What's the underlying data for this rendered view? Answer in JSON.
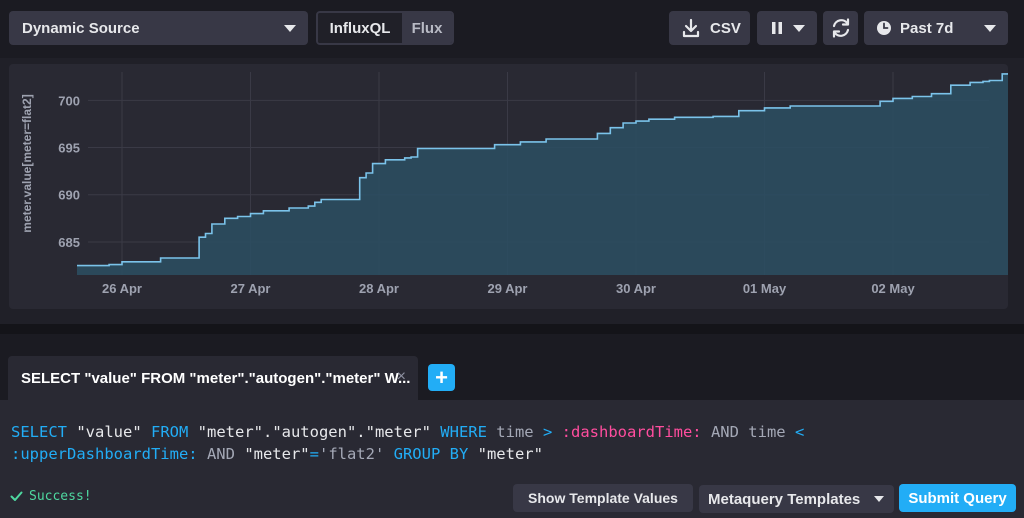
{
  "toolbar": {
    "source_label": "Dynamic Source",
    "lang_influxql": "InfluxQL",
    "lang_flux": "Flux",
    "csv_label": "CSV",
    "time_range_label": "Past 7d"
  },
  "chart_data": {
    "type": "area",
    "ylabel": "meter.value[meter=flat2]",
    "xlabel": "",
    "x_ticks": [
      "26 Apr",
      "27 Apr",
      "28 Apr",
      "29 Apr",
      "30 Apr",
      "01 May",
      "02 May"
    ],
    "y_ticks": [
      685,
      690,
      695,
      700
    ],
    "ylim": [
      681.5,
      703
    ],
    "grid": true,
    "series": [
      {
        "color": "#7bc3ea",
        "x": [
          25.65,
          25.9,
          26.0,
          26.3,
          26.55,
          26.6,
          26.65,
          26.7,
          26.8,
          26.9,
          27.0,
          27.1,
          27.3,
          27.45,
          27.5,
          27.55,
          27.65,
          27.75,
          27.85,
          27.87,
          27.9,
          27.95,
          28.05,
          28.2,
          28.25,
          28.3,
          28.35,
          28.6,
          28.75,
          28.9,
          29.1,
          29.3,
          29.5,
          29.7,
          29.8,
          29.9,
          30.0,
          30.1,
          30.3,
          30.6,
          30.8,
          31.0,
          31.2,
          31.5,
          31.7,
          31.9,
          32.0,
          32.15,
          32.3,
          32.45,
          32.55,
          32.6,
          32.7,
          32.75,
          32.85,
          32.9
        ],
        "y": [
          682.5,
          682.6,
          682.9,
          683.3,
          683.3,
          685.5,
          685.9,
          686.9,
          687.5,
          687.7,
          688.0,
          688.3,
          688.6,
          688.8,
          689.2,
          689.5,
          689.5,
          689.5,
          691.8,
          691.8,
          692.3,
          693.3,
          693.7,
          693.9,
          694.0,
          694.9,
          694.9,
          694.9,
          694.9,
          695.3,
          695.6,
          695.9,
          695.9,
          696.5,
          697.1,
          697.6,
          697.8,
          698.0,
          698.2,
          698.3,
          698.9,
          699.2,
          699.4,
          699.4,
          699.4,
          699.9,
          700.2,
          700.4,
          700.7,
          701.6,
          701.6,
          701.9,
          702.0,
          702.1,
          702.8,
          702.9
        ]
      }
    ]
  },
  "query_tab": {
    "label": "SELECT \"value\" FROM \"meter\".\"autogen\".\"meter\" W...",
    "close": "×",
    "add": "+"
  },
  "editor": {
    "line1": {
      "kw_select": "SELECT",
      "t1": " \"value\" ",
      "kw_from": "FROM",
      "t2": " \"meter\".\"autogen\".\"meter\" ",
      "kw_where": "WHERE",
      "t3": " time ",
      "op_gt": ">",
      "t4": " ",
      "tmpl1": ":dashboardTime:",
      "t5": " AND time ",
      "op_lt": "<"
    },
    "line2": {
      "tmpl2": ":upperDashboardTime:",
      "t6": " AND ",
      "t7": "\"meter\"",
      "op_eq": "=",
      "t8": "'flat2' ",
      "kw_group": "GROUP BY",
      "t9": " \"meter\""
    }
  },
  "status": {
    "text": "Success!"
  },
  "actions": {
    "show_template_values": "Show Template Values",
    "metaquery_templates": "Metaquery Templates",
    "submit_query": "Submit Query"
  }
}
